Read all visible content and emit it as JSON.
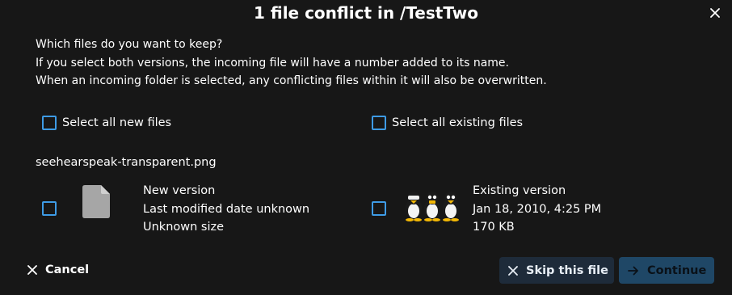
{
  "dialog": {
    "title": "1 file conflict in /TestTwo",
    "close_icon": "close-icon"
  },
  "intro": {
    "line1": "Which files do you want to keep?",
    "line2": "If you select both versions, the incoming file will have a number added to its name.",
    "line3": "When an incoming folder is selected, any conflicting files within it will also be overwritten."
  },
  "select_all": {
    "new_label": "Select all new files",
    "existing_label": "Select all existing files",
    "new_checked": false,
    "existing_checked": false
  },
  "conflict": {
    "filename": "seehearspeak-transparent.png",
    "new": {
      "title": "New version",
      "modified": "Last modified date unknown",
      "size": "Unknown size",
      "icon": "file-icon",
      "checked": false
    },
    "existing": {
      "title": "Existing version",
      "modified": "Jan 18, 2010, 4:25 PM",
      "size": "170 KB",
      "thumbnail": "penguins-thumbnail",
      "checked": false
    }
  },
  "actions": {
    "cancel_label": "Cancel",
    "skip_label": "Skip this file",
    "continue_label": "Continue"
  },
  "colors": {
    "background": "#171717",
    "accent": "#3e9be5",
    "skip_bg": "#1e2b3a",
    "continue_bg": "#1f4766"
  }
}
